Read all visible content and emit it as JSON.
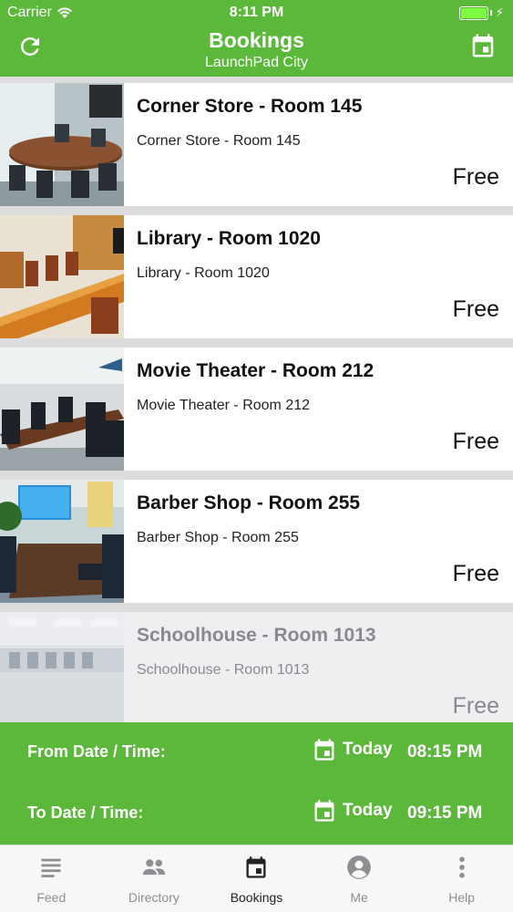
{
  "status_bar": {
    "carrier": "Carrier",
    "time": "8:11 PM"
  },
  "header": {
    "title": "Bookings",
    "subtitle": "LaunchPad City",
    "left_icon": "refresh-icon",
    "right_icon": "calendar-icon"
  },
  "rooms": [
    {
      "title": "Corner Store - Room 145",
      "subtitle": "Corner Store - Room 145",
      "status": "Free"
    },
    {
      "title": "Library - Room 1020",
      "subtitle": "Library - Room 1020",
      "status": "Free"
    },
    {
      "title": "Movie Theater - Room 212",
      "subtitle": "Movie Theater - Room 212",
      "status": "Free"
    },
    {
      "title": "Barber Shop - Room 255",
      "subtitle": "Barber Shop - Room 255",
      "status": "Free"
    },
    {
      "title": "Schoolhouse - Room 1013",
      "subtitle": "Schoolhouse - Room 1013",
      "status": "Free"
    }
  ],
  "date_panel": {
    "from": {
      "label": "From Date / Time:",
      "date": "Today",
      "time": "08:15 PM"
    },
    "to": {
      "label": "To Date / Time:",
      "date": "Today",
      "time": "09:15 PM"
    }
  },
  "tabs": [
    {
      "label": "Feed",
      "icon": "feed-icon"
    },
    {
      "label": "Directory",
      "icon": "people-icon"
    },
    {
      "label": "Bookings",
      "icon": "calendar-icon",
      "active": true
    },
    {
      "label": "Me",
      "icon": "person-icon"
    },
    {
      "label": "Help",
      "icon": "more-vertical-icon"
    }
  ],
  "colors": {
    "brand_green": "#5cb83a",
    "tab_active": "#222222",
    "tab_inactive": "#8e8e93"
  }
}
